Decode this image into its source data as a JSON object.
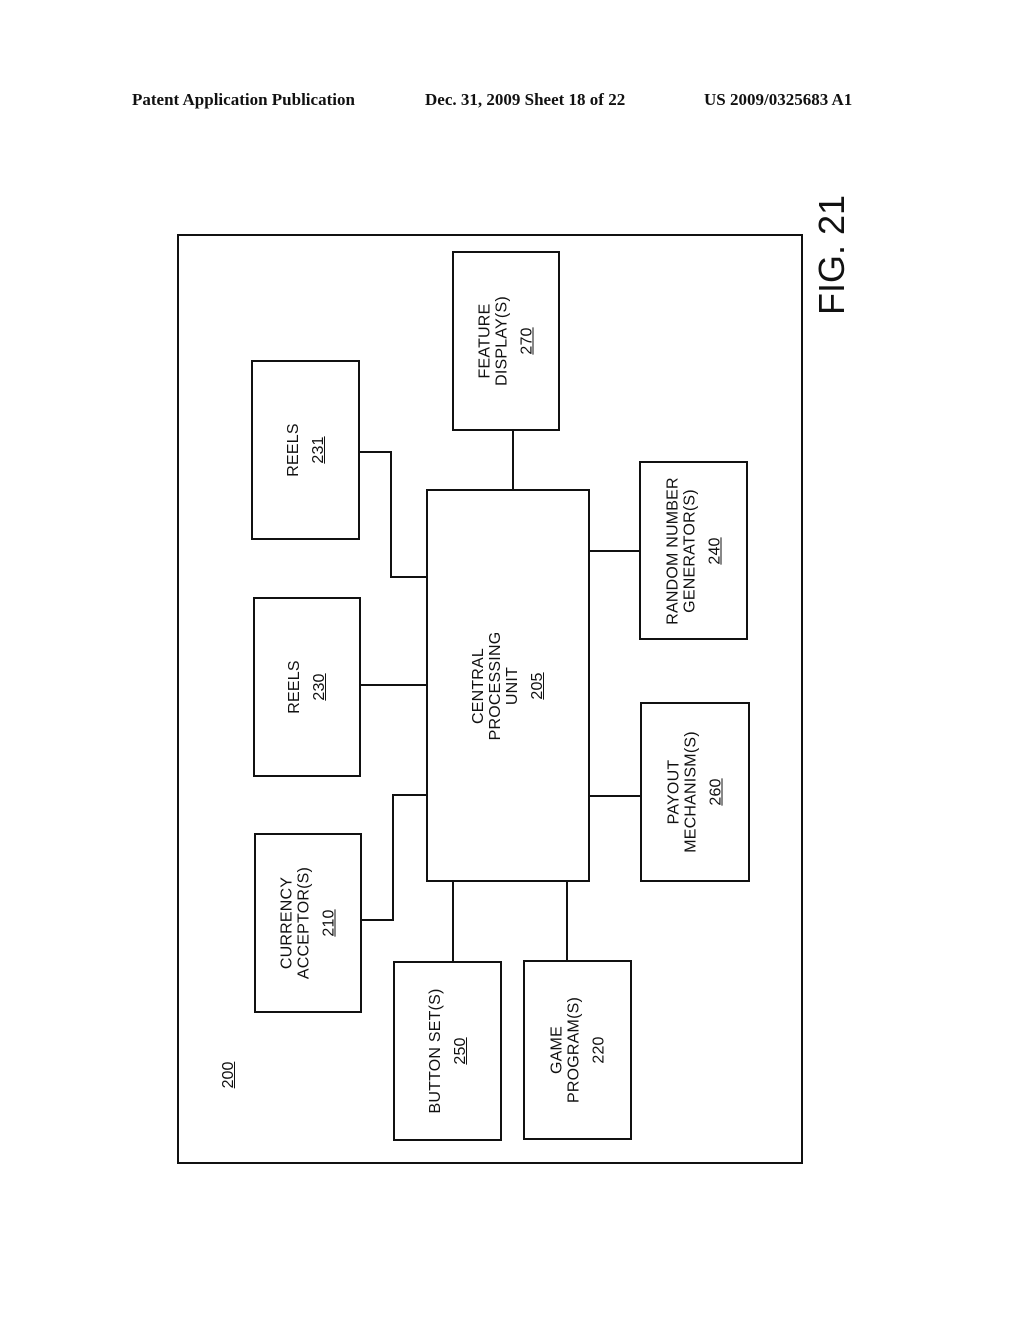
{
  "header": {
    "left": "Patent Application Publication",
    "middle": "Dec. 31, 2009   Sheet 18 of 22",
    "right": "US 2009/0325683 A1"
  },
  "figure": {
    "label": "FIG. 21",
    "system_ref": "200",
    "nodes": [
      {
        "id": "cpu",
        "lines": [
          "CENTRAL",
          "PROCESSING",
          "UNIT"
        ],
        "ref": "205",
        "ref_underlined": true
      },
      {
        "id": "reels231",
        "lines": [
          "REELS"
        ],
        "ref": "231",
        "ref_underlined": true
      },
      {
        "id": "reels230",
        "lines": [
          "REELS"
        ],
        "ref": "230",
        "ref_underlined": true
      },
      {
        "id": "currency",
        "lines": [
          "CURRENCY",
          "ACCEPTOR(S)"
        ],
        "ref": "210",
        "ref_underlined": true
      },
      {
        "id": "feature",
        "lines": [
          "FEATURE",
          "DISPLAY(S)"
        ],
        "ref": "270",
        "ref_underlined": true
      },
      {
        "id": "rng",
        "lines": [
          "RANDOM NUMBER",
          "GENERATOR(S)"
        ],
        "ref": "240",
        "ref_underlined": true
      },
      {
        "id": "payout",
        "lines": [
          "PAYOUT",
          "MECHANISM(S)"
        ],
        "ref": "260",
        "ref_underlined": true
      },
      {
        "id": "buttons",
        "lines": [
          "BUTTON SET(S)"
        ],
        "ref": "250",
        "ref_underlined": true
      },
      {
        "id": "game",
        "lines": [
          "GAME",
          "PROGRAM(S)"
        ],
        "ref": "220",
        "ref_underlined": false
      }
    ],
    "connections": [
      [
        "cpu",
        "reels231"
      ],
      [
        "cpu",
        "reels230"
      ],
      [
        "cpu",
        "currency"
      ],
      [
        "cpu",
        "feature"
      ],
      [
        "cpu",
        "rng"
      ],
      [
        "cpu",
        "payout"
      ],
      [
        "cpu",
        "buttons"
      ],
      [
        "cpu",
        "game"
      ]
    ]
  }
}
